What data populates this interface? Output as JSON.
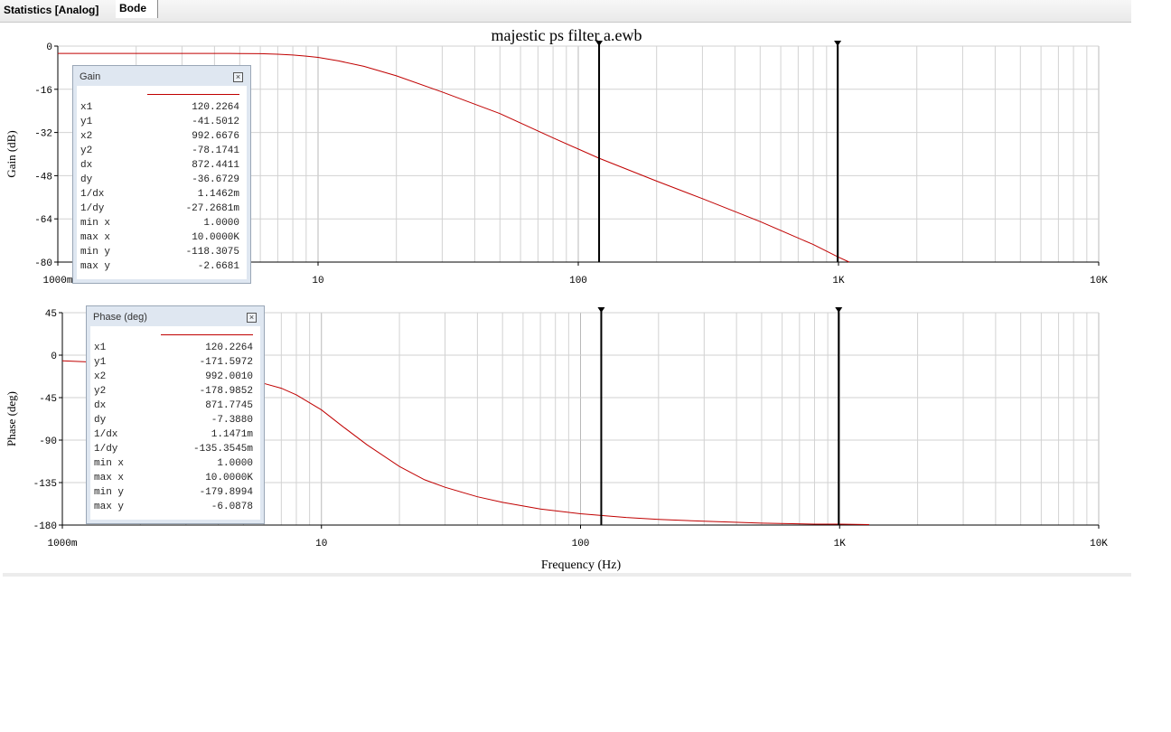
{
  "tabs": [
    {
      "label": "Statistics [Analog]"
    },
    {
      "label": "Bode"
    }
  ],
  "title": "majestic ps filter a.ewb",
  "chart_data": [
    {
      "type": "line",
      "name": "gain",
      "title": "majestic ps filter a.ewb",
      "xscale": "log",
      "xlim": [
        1,
        10000
      ],
      "ylim": [
        -80,
        0
      ],
      "xlabel": "",
      "ylabel": "Gain (dB)",
      "x_tick_labels": [
        "1000m",
        "10",
        "100",
        "1K",
        "10K"
      ],
      "y_tick_labels": [
        "0",
        "-16",
        "-32",
        "-48",
        "-64",
        "-80"
      ],
      "y_ticks": [
        0,
        -16,
        -32,
        -48,
        -64,
        -80
      ],
      "grid": true,
      "series_color": "#c00000",
      "series": [
        {
          "x": [
            1,
            2,
            3,
            4,
            5,
            6,
            7,
            8,
            9,
            10,
            12,
            15,
            20,
            30,
            50,
            80,
            120,
            200,
            300,
            500,
            800,
            1000,
            1100
          ],
          "y": [
            -2.7,
            -2.7,
            -2.7,
            -2.7,
            -2.75,
            -2.8,
            -3.0,
            -3.3,
            -3.7,
            -4.2,
            -5.5,
            -7.5,
            -11,
            -17,
            -25,
            -34,
            -41.5,
            -50,
            -56.5,
            -65,
            -73.5,
            -78.2,
            -80
          ]
        }
      ],
      "cursors_x": [
        120.2264,
        992.6676
      ]
    },
    {
      "type": "line",
      "name": "phase",
      "xscale": "log",
      "xlim": [
        1,
        10000
      ],
      "ylim": [
        -180,
        45
      ],
      "xlabel": "Frequency (Hz)",
      "ylabel": "Phase (deg)",
      "x_tick_labels": [
        "1000m",
        "10",
        "100",
        "1K",
        "10K"
      ],
      "y_tick_labels": [
        "45",
        "0",
        "-45",
        "-90",
        "-135",
        "-180"
      ],
      "y_ticks": [
        45,
        0,
        -45,
        -90,
        -135,
        -180
      ],
      "grid": true,
      "series_color": "#c00000",
      "series": [
        {
          "x": [
            1,
            1.5,
            2,
            3,
            4,
            5,
            6,
            7,
            8,
            10,
            12,
            15,
            20,
            25,
            30,
            40,
            50,
            70,
            100,
            150,
            200,
            300,
            500,
            800,
            1000,
            1300
          ],
          "y": [
            -6,
            -8,
            -10,
            -15,
            -20,
            -25,
            -30,
            -35,
            -42,
            -58,
            -75,
            -95,
            -118,
            -132,
            -140,
            -150,
            -156,
            -163,
            -168,
            -172,
            -174,
            -176,
            -178,
            -179,
            -179,
            -179.5
          ]
        }
      ],
      "cursors_x": [
        120.2264,
        992.001
      ]
    }
  ],
  "gain_panel": {
    "title": "Gain",
    "rows": [
      {
        "k": "x1",
        "v": "120.2264"
      },
      {
        "k": "y1",
        "v": "-41.5012"
      },
      {
        "k": "x2",
        "v": "992.6676"
      },
      {
        "k": "y2",
        "v": "-78.1741"
      },
      {
        "k": "dx",
        "v": "872.4411"
      },
      {
        "k": "dy",
        "v": "-36.6729"
      },
      {
        "k": "1/dx",
        "v": "1.1462m"
      },
      {
        "k": "1/dy",
        "v": "-27.2681m"
      },
      {
        "k": "min x",
        "v": "1.0000"
      },
      {
        "k": "max x",
        "v": "10.0000K"
      },
      {
        "k": "min y",
        "v": "-118.3075"
      },
      {
        "k": "max y",
        "v": "-2.6681"
      }
    ]
  },
  "phase_panel": {
    "title": "Phase (deg)",
    "rows": [
      {
        "k": "x1",
        "v": "120.2264"
      },
      {
        "k": "y1",
        "v": "-171.5972"
      },
      {
        "k": "x2",
        "v": "992.0010"
      },
      {
        "k": "y2",
        "v": "-178.9852"
      },
      {
        "k": "dx",
        "v": "871.7745"
      },
      {
        "k": "dy",
        "v": "-7.3880"
      },
      {
        "k": "1/dx",
        "v": "1.1471m"
      },
      {
        "k": "1/dy",
        "v": "-135.3545m"
      },
      {
        "k": "min x",
        "v": "1.0000"
      },
      {
        "k": "max x",
        "v": "10.0000K"
      },
      {
        "k": "min y",
        "v": "-179.8994"
      },
      {
        "k": "max y",
        "v": "-6.0878"
      }
    ]
  },
  "close_glyph": "×"
}
